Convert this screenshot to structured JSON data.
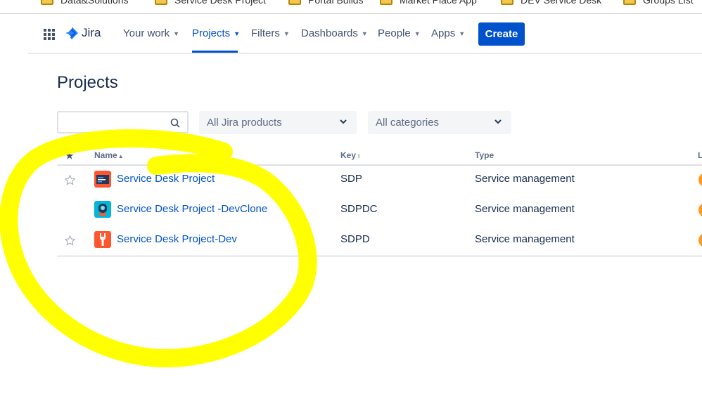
{
  "bookmarks": [
    {
      "label": "Data&Solutions"
    },
    {
      "label": "Service Desk Project"
    },
    {
      "label": "Portal Builds"
    },
    {
      "label": "Market Place App"
    },
    {
      "label": "DEV Service Desk"
    },
    {
      "label": "Groups List"
    }
  ],
  "nav": {
    "logo_text": "Jira",
    "items": [
      {
        "label": "Your work"
      },
      {
        "label": "Projects"
      },
      {
        "label": "Filters"
      },
      {
        "label": "Dashboards"
      },
      {
        "label": "People"
      },
      {
        "label": "Apps"
      }
    ],
    "active": "Projects",
    "create_label": "Create"
  },
  "page": {
    "title": "Projects",
    "search": {
      "value": "",
      "placeholder": ""
    },
    "filters": [
      {
        "value": "All Jira products"
      },
      {
        "value": "All categories"
      }
    ]
  },
  "table": {
    "columns": {
      "star": "★",
      "name": "Name",
      "key": "Key",
      "type": "Type",
      "lead": "L"
    },
    "rows": [
      {
        "name": "Service Desk Project",
        "key": "SDP",
        "type": "Service management",
        "starred": false,
        "avatar": "dark-screen-avatar"
      },
      {
        "name": "Service Desk Project -DevClone",
        "key": "SDPDC",
        "type": "Service management",
        "starred": false,
        "avatar": "robot-avatar"
      },
      {
        "name": "Service Desk Project-Dev",
        "key": "SDPD",
        "type": "Service management",
        "starred": false,
        "avatar": "wrench-avatar"
      }
    ]
  },
  "colors": {
    "brand": "#0052CC",
    "highlight": "#FFFF00",
    "lead_avatar": "#FF991F"
  }
}
